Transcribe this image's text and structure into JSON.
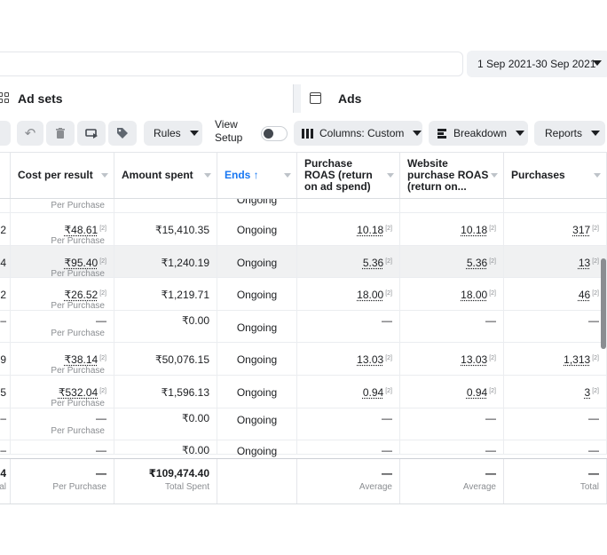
{
  "header": {
    "date_range": "1 Sep 2021-30 Sep 2021"
  },
  "tabs": {
    "adsets_label": "Ad sets",
    "ads_label": "Ads"
  },
  "toolbar": {
    "rules_label": "Rules",
    "view_setup_label": "View Setup",
    "columns_label": "Columns: Custom",
    "breakdown_label": "Breakdown",
    "reports_label": "Reports"
  },
  "table": {
    "headers": {
      "cost_per_result": "Cost per result",
      "amount_spent": "Amount spent",
      "ends": "Ends ↑",
      "purchase_roas": "Purchase ROAS (return on ad spend)",
      "website_purchase_roas": "Website purchase ROAS (return on...",
      "purchases": "Purchases"
    },
    "partial_top": {
      "cost_sub": "Per Purchase",
      "ends": "Ongoing"
    },
    "rows": [
      {
        "lead": "2",
        "cost": "₹48.61",
        "cost_sub": "Per Purchase",
        "spent": "₹15,410.35",
        "ends": "Ongoing",
        "roas": "10.18",
        "web_roas": "10.18",
        "purchases": "317"
      },
      {
        "lead": "4",
        "cost": "₹95.40",
        "cost_sub": "Per Purchase",
        "spent": "₹1,240.19",
        "ends": "Ongoing",
        "roas": "5.36",
        "web_roas": "5.36",
        "purchases": "13"
      },
      {
        "lead": "2",
        "cost": "₹26.52",
        "cost_sub": "Per Purchase",
        "spent": "₹1,219.71",
        "ends": "Ongoing",
        "roas": "18.00",
        "web_roas": "18.00",
        "purchases": "46"
      },
      {
        "lead": "–",
        "cost": "—",
        "cost_sub": "Per Purchase",
        "spent": "₹0.00",
        "ends": "Ongoing",
        "roas": "—",
        "web_roas": "—",
        "purchases": "—"
      },
      {
        "lead": "9",
        "cost": "₹38.14",
        "cost_sub": "Per Purchase",
        "spent": "₹50,076.15",
        "ends": "Ongoing",
        "roas": "13.03",
        "web_roas": "13.03",
        "purchases": "1,313"
      },
      {
        "lead": "5",
        "cost": "₹532.04",
        "cost_sub": "Per Purchase",
        "spent": "₹1,596.13",
        "ends": "Ongoing",
        "roas": "0.94",
        "web_roas": "0.94",
        "purchases": "3"
      },
      {
        "lead": "–",
        "cost": "—",
        "cost_sub": "Per Purchase",
        "spent": "₹0.00",
        "ends": "Ongoing",
        "roas": "—",
        "web_roas": "—",
        "purchases": "—"
      },
      {
        "lead": "–",
        "cost": "—",
        "cost_sub": "",
        "spent": "₹0.00",
        "ends": "Ongoing",
        "roas": "—",
        "web_roas": "—",
        "purchases": "—"
      }
    ],
    "footnote_mark": "[2]",
    "totals": {
      "lead": "4",
      "lead_sub": "al",
      "cost": "—",
      "cost_sub": "Per Purchase",
      "spent": "₹109,474.40",
      "spent_sub": "Total Spent",
      "roas": "—",
      "roas_sub": "Average",
      "web_roas": "—",
      "web_roas_sub": "Average",
      "purchases": "—",
      "purchases_sub": "Total"
    }
  }
}
